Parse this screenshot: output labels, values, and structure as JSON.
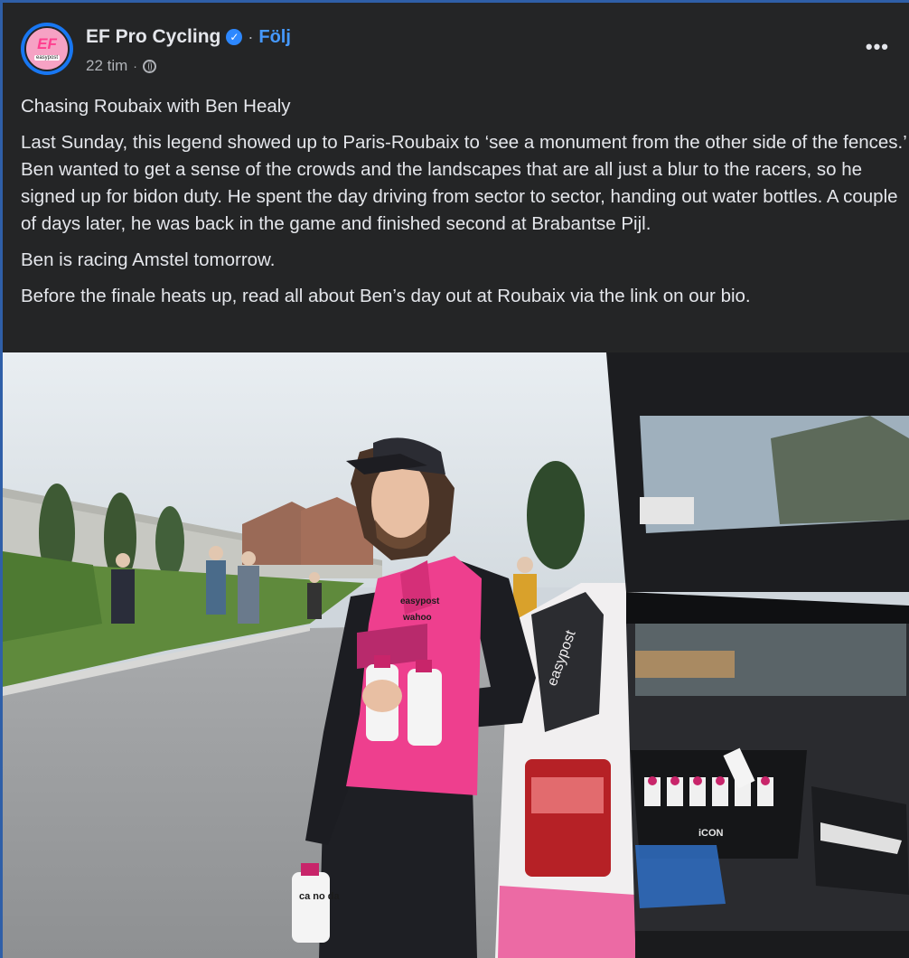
{
  "post": {
    "author": "EF Pro Cycling",
    "avatar_text": "EF",
    "avatar_subtext": "easypost",
    "follow_label": "Följ",
    "separator": "·",
    "timestamp": "22 tim",
    "paragraphs": [
      "Chasing Roubaix with Ben Healy",
      "Last Sunday, this legend showed up to Paris-Roubaix to ‘see a monument from the other side of the fences.’ Ben wanted to get a sense of the crowds and the landscapes that are all just a blur to the racers, so he signed up for bidon duty. He spent the day driving from sector to sector, handing out water bottles. A couple of days later, he was back in the game and finished second at Brabantse Pijl.",
      "Ben is racing Amstel tomorrow.",
      "Before the finale heats up, read all about Ben’s day out at Roubaix via the link on our bio."
    ],
    "more_icon": "more-horizontal-icon",
    "verified_icon": "verified-badge-icon",
    "audience_icon": "globe-icon"
  },
  "photo": {
    "jersey_text_1": "easypost",
    "jersey_text_2": "wahoo",
    "bottle_text": "ca no da",
    "basket_text": "iCON",
    "car_door_text": "easypost"
  },
  "colors": {
    "background": "#242526",
    "accent": "#4599ff",
    "text": "#e4e6eb",
    "secondary_text": "#b0b3b8",
    "jersey_pink": "#ee3f8e"
  }
}
